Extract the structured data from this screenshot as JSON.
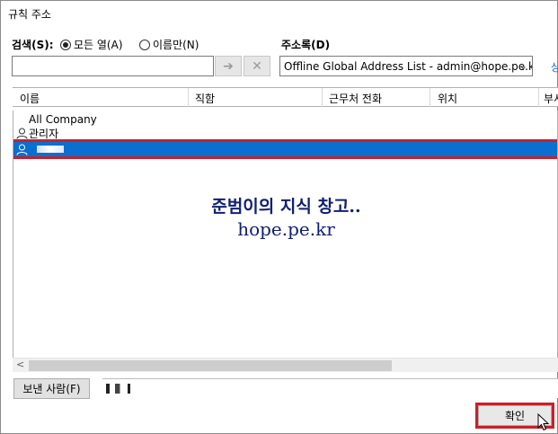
{
  "window": {
    "title": "규칙 주소"
  },
  "search": {
    "label": "검색(S):",
    "option_all_columns": "모든 열(A)",
    "option_name_only": "이름만(N)",
    "input_value": "",
    "go_icon": "arrow-right-icon",
    "clear_icon": "x-icon"
  },
  "address_book": {
    "label": "주소록(D)",
    "selected": "Offline Global Address List - admin@hope.pe.kr",
    "advanced_link": "상"
  },
  "columns": [
    "이름",
    "직함",
    "근무처 전화",
    "위치",
    "부서"
  ],
  "entries": [
    {
      "name": "All Company",
      "icon": ""
    },
    {
      "name": "관리자",
      "icon": "person-icon"
    }
  ],
  "watermark": {
    "line1": "준범이의 지식 창고..",
    "line2": "hope.pe.kr"
  },
  "recipients": {
    "button_label": "보낸 사람(F)"
  },
  "footer": {
    "ok_label": "확인"
  },
  "colors": {
    "selection": "#0a6fd0",
    "highlight": "#c8202a",
    "watermark": "#102070",
    "link": "#1a6fc7"
  }
}
